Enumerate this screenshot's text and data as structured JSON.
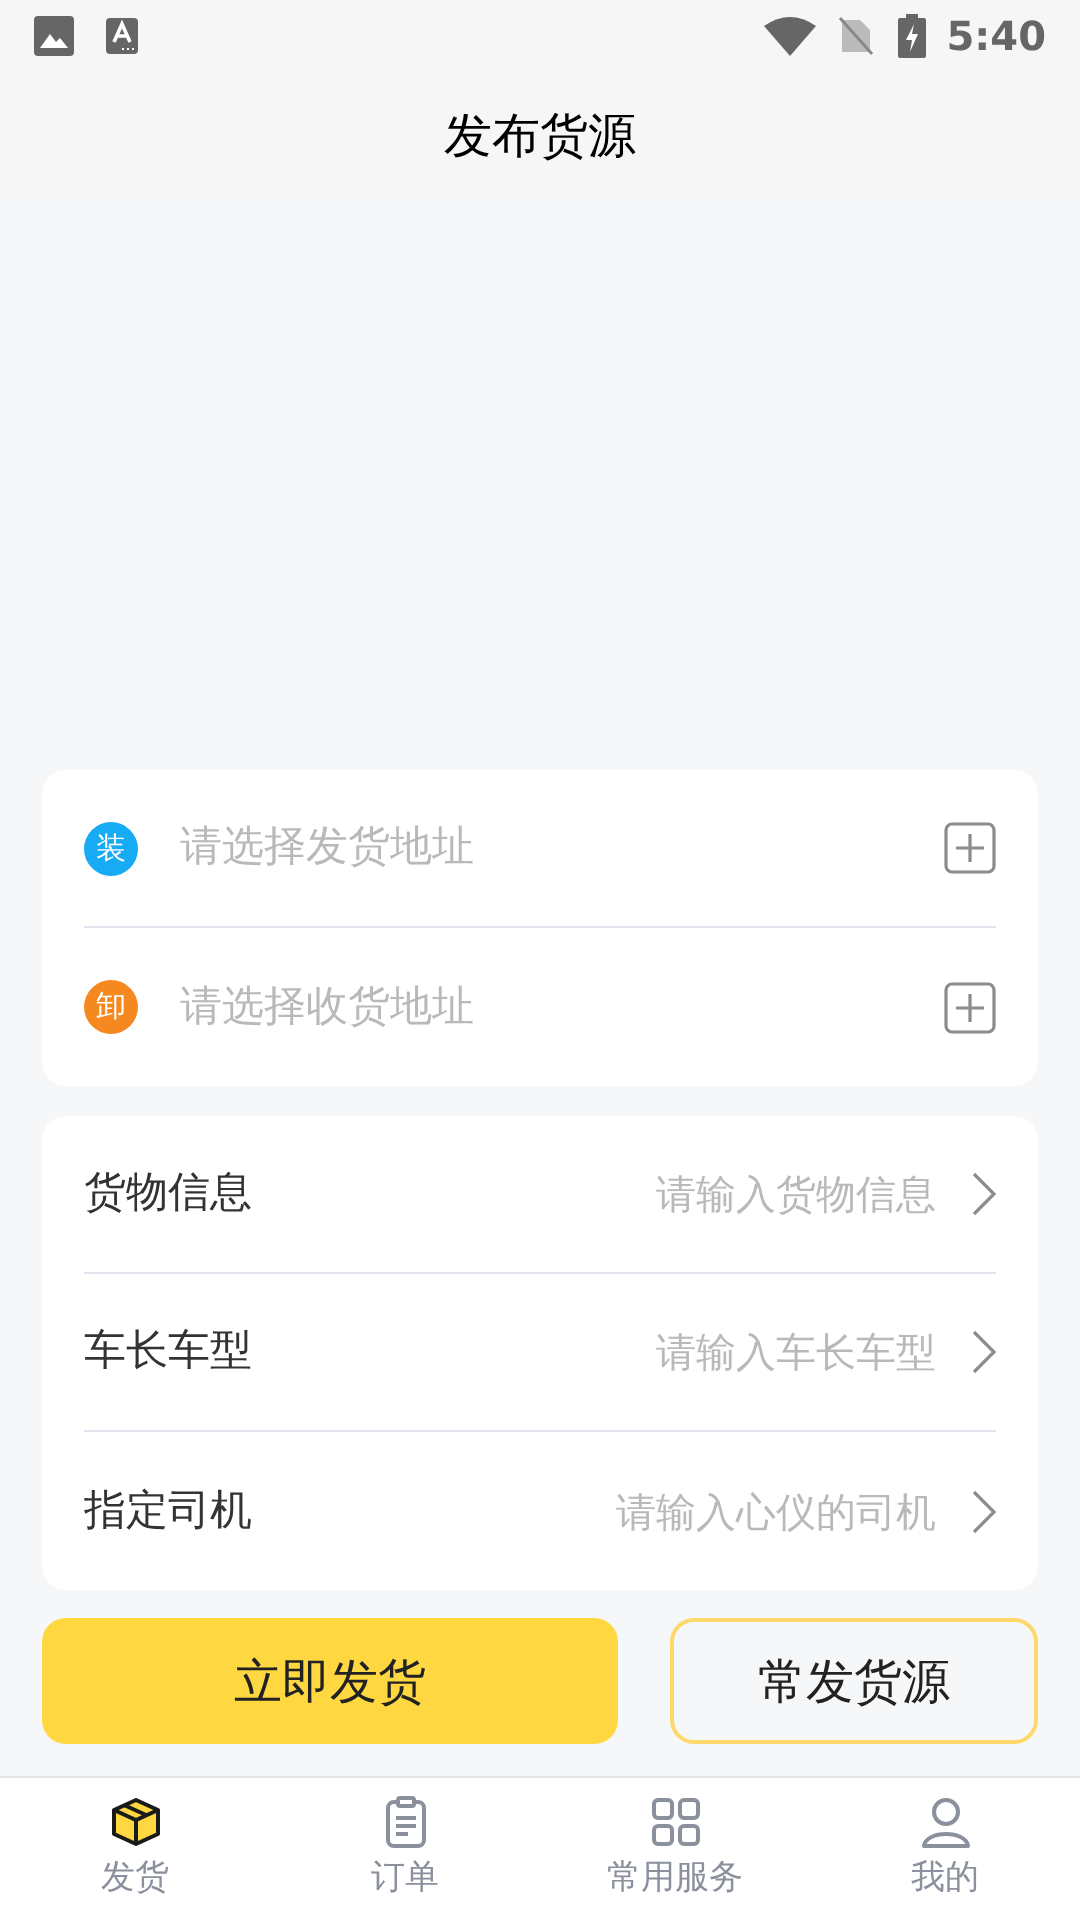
{
  "status_bar": {
    "time": "5:40"
  },
  "header": {
    "title": "发布货源"
  },
  "addresses": [
    {
      "badge": "装",
      "color": "#17aaf5",
      "placeholder": "请选择发货地址"
    },
    {
      "badge": "卸",
      "color": "#f5891f",
      "placeholder": "请选择收货地址"
    }
  ],
  "info_rows": [
    {
      "label": "货物信息",
      "placeholder": "请输入货物信息"
    },
    {
      "label": "车长车型",
      "placeholder": "请输入车长车型"
    },
    {
      "label": "指定司机",
      "placeholder": "请输入心仪的司机"
    }
  ],
  "buttons": [
    {
      "label": "立即发货",
      "kind": "primary"
    },
    {
      "label": "常发货源",
      "kind": "outline"
    }
  ],
  "tabs": [
    {
      "label": "发货",
      "kind": "box",
      "selected": true
    },
    {
      "label": "订单",
      "kind": "clipboard",
      "selected": false
    },
    {
      "label": "常用服务",
      "kind": "grid",
      "selected": false
    },
    {
      "label": "我的",
      "kind": "person",
      "selected": false
    }
  ]
}
